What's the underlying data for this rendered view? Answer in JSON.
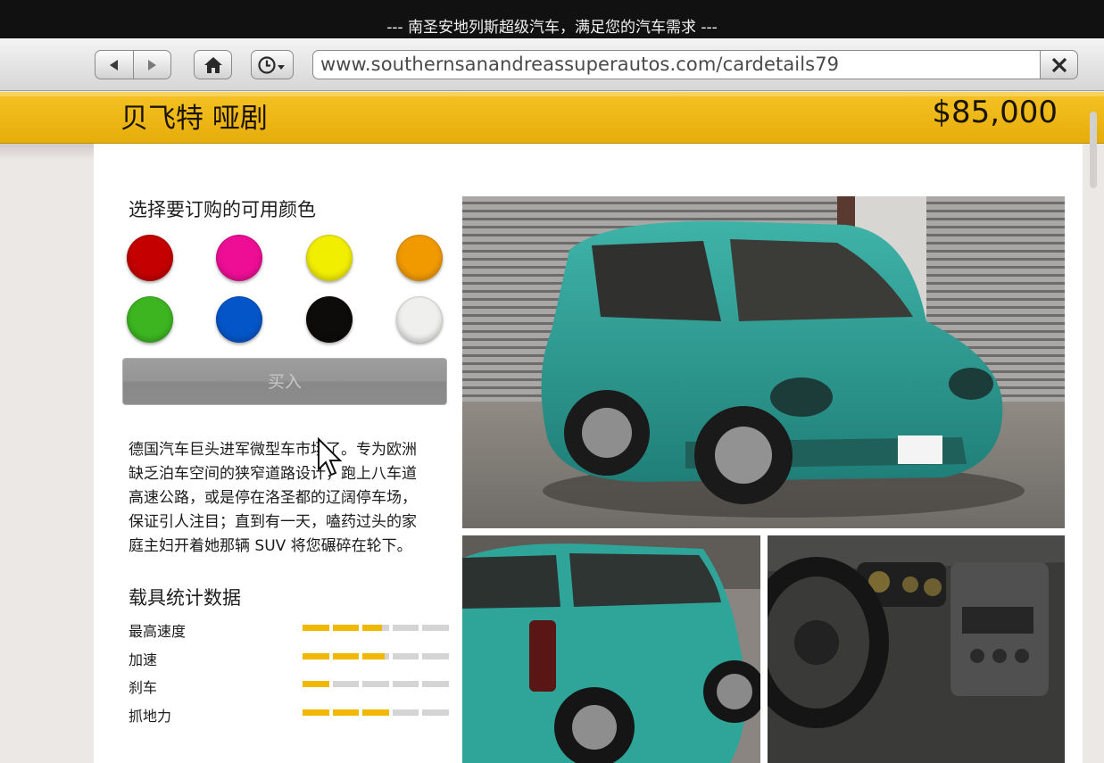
{
  "window": {
    "title": "--- 南圣安地列斯超级汽车，满足您的汽车需求 ---"
  },
  "browser": {
    "url": "www.southernsanandreassuperautos.com/cardetails79",
    "icons": [
      "back-arrow-icon",
      "forward-arrow-icon",
      "home-icon",
      "history-clock-icon",
      "close-x-icon"
    ]
  },
  "car": {
    "name": "贝飞特 哑剧",
    "price": "$85,000"
  },
  "colors_section": {
    "title": "选择要订购的可用颜色",
    "swatches": [
      "#c40000",
      "#ee0e96",
      "#f2ee00",
      "#f19a00",
      "#3cb521",
      "#0456c8",
      "#0e0c0b",
      "#efefed"
    ]
  },
  "buy_button": {
    "label": "买入"
  },
  "description": "德国汽车巨头进军微型车市场了。专为欧洲\n缺乏泊车空间的狭窄道路设计，跑上八车道\n高速公路，或是停在洛圣都的辽阔停车场，\n保证引人注目；直到有一天，嗑药过头的家\n庭主妇开着她那辆 SUV 将您碾碎在轮下。",
  "stats": {
    "title": "载具统计数据",
    "items": [
      {
        "label": "最高速度",
        "value": 0.55
      },
      {
        "label": "加速",
        "value": 0.57
      },
      {
        "label": "刹车",
        "value": 0.2
      },
      {
        "label": "抓地力",
        "value": 0.6
      }
    ]
  },
  "gallery": {
    "images": [
      "car-front-view-image",
      "car-rear-view-image",
      "car-interior-image"
    ]
  }
}
